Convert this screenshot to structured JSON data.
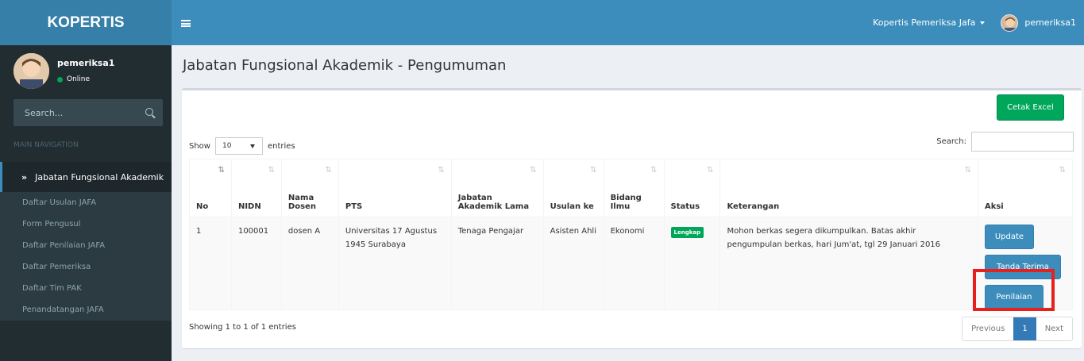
{
  "header": {
    "logo": "KOPERTIS",
    "account_menu": "Kopertis Pemeriksa Jafa",
    "username": "pemeriksa1"
  },
  "sidebar": {
    "username": "pemeriksa1",
    "status": "Online",
    "search_placeholder": "Search...",
    "nav_header": "MAIN NAVIGATION",
    "active_menu": "Jabatan Fungsional Akademik",
    "submenu": [
      "Daftar Usulan JAFA",
      "Form Pengusul",
      "Daftar Penilaian JAFA",
      "Daftar Pemeriksa",
      "Daftar Tim PAK",
      "Penandatangan JAFA"
    ]
  },
  "page": {
    "title": "Jabatan Fungsional Akademik - Pengumuman"
  },
  "toolbar": {
    "excel_button": "Cetak Excel",
    "show_label": "Show",
    "entries_value": "10",
    "entries_label": "entries",
    "search_label": "Search:"
  },
  "table": {
    "headers": [
      "No",
      "NIDN",
      "Nama Dosen",
      "PTS",
      "Jabatan Akademik Lama",
      "Usulan ke",
      "Bidang Ilmu",
      "Status",
      "Keterangan",
      "Aksi"
    ],
    "row": {
      "no": "1",
      "nidn": "100001",
      "nama": "dosen A",
      "pts": "Universitas 17 Agustus 1945 Surabaya",
      "jabatan": "Tenaga Pengajar",
      "usulan": "Asisten Ahli",
      "bidang": "Ekonomi",
      "status": "Lengkap",
      "keterangan": "Mohon berkas segera dikumpulkan. Batas akhir pengumpulan berkas, hari Jum'at, tgl 29 Januari 2016",
      "actions": [
        "Update",
        "Tanda Terima",
        "Penilaian"
      ]
    }
  },
  "footer": {
    "info": "Showing 1 to 1 of 1 entries",
    "previous": "Previous",
    "page": "1",
    "next": "Next"
  },
  "colors": {
    "header": "#3c8dbc",
    "logo": "#367fa9",
    "sidebar": "#222d32",
    "success": "#00a65a",
    "highlight": "#e8201d"
  }
}
